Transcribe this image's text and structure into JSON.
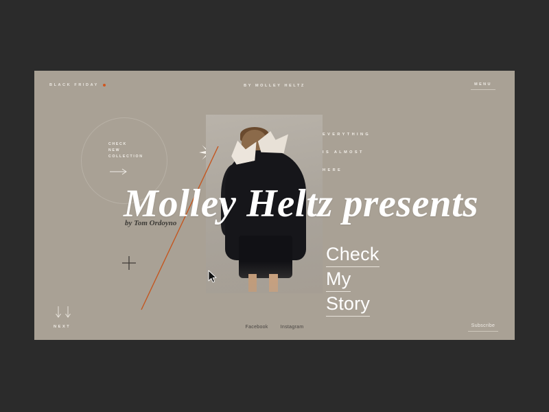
{
  "theme": {
    "frame_color": "#2b2b2b",
    "page_background": "#a9a195",
    "accent_color": "#d1561f",
    "text_light": "#f0ece6",
    "text_dark": "#3c3a36"
  },
  "topbar": {
    "brand_left": "BLACK FRIDAY",
    "brand_center": "BY MOLLEY HELTZ",
    "menu_label": "MENU"
  },
  "circle_badge": {
    "line1": "CHECK",
    "line2": "NEW",
    "line3": "COLLECTION",
    "arrow_icon": "arrow-right-icon"
  },
  "side_text": {
    "line1": "EVERYTHING",
    "line2": "IS ALMOST",
    "line3": "HERE"
  },
  "hero": {
    "headline": "Molley Heltz presents",
    "byline": "by Tom Ordoyno"
  },
  "story_cta": {
    "line1": "Check",
    "line2": "My",
    "line3": "Story"
  },
  "decorations": {
    "star_icon": "eight-point-star-icon",
    "plus_icon": "plus-icon",
    "diagonal_line": "orange-diagonal-line",
    "cursor_icon": "mouse-cursor-icon"
  },
  "footer": {
    "next_label": "NEXT",
    "next_arrows_icon": "double-arrow-down-icon",
    "social": [
      {
        "label": "Facebook"
      },
      {
        "label": "Instagram"
      }
    ],
    "subscribe_label": "Subscribe"
  }
}
